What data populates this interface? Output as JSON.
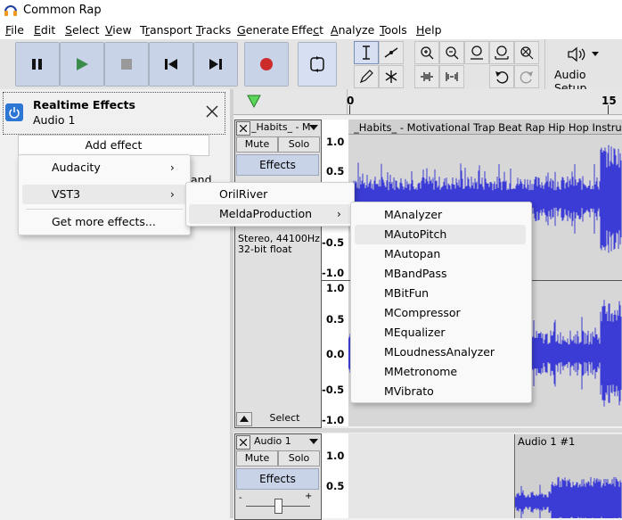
{
  "window": {
    "title": "Common Rap"
  },
  "menubar": [
    {
      "label": "File",
      "u": "F",
      "rest": "ile"
    },
    {
      "label": "Edit",
      "u": "E",
      "rest": "dit"
    },
    {
      "label": "Select",
      "u": "S",
      "rest": "elect"
    },
    {
      "label": "View",
      "u": "V",
      "rest": "iew"
    },
    {
      "label": "Transport",
      "pre": "T",
      "u": "r",
      "rest": "ansport"
    },
    {
      "label": "Tracks",
      "u": "T",
      "rest": "racks"
    },
    {
      "label": "Generate",
      "u": "G",
      "rest": "enerate"
    },
    {
      "label": "Effect",
      "pre": "Effe",
      "u": "c",
      "rest": "t"
    },
    {
      "label": "Analyze",
      "u": "A",
      "rest": "nalyze"
    },
    {
      "label": "Tools",
      "u": "T",
      "rest": "ools"
    },
    {
      "label": "Help",
      "u": "H",
      "rest": "elp"
    }
  ],
  "toolbar": {
    "audio_setup_label": "Audio Setup"
  },
  "realtime": {
    "title": "Realtime Effects",
    "track": "Audio 1",
    "add_effect": "Add effect",
    "partial_text": "and"
  },
  "ruler": {
    "start": "0",
    "mark": "15"
  },
  "track1": {
    "name": "_Habits_ - M",
    "clip_title": "_Habits_ - Motivational Trap Beat  Rap Hip Hop Instrum",
    "mute": "Mute",
    "solo": "Solo",
    "effects": "Effects",
    "format": "Stereo, 44100Hz",
    "bits": "32-bit float",
    "select": "Select",
    "scale": [
      "1.0",
      "0.5",
      "-0.5",
      "-1.0",
      "1.0",
      "0.5",
      "0.0",
      "-0.5",
      "-1.0"
    ]
  },
  "track2": {
    "name": "Audio 1",
    "clip_title": "Audio 1 #1",
    "mute": "Mute",
    "solo": "Solo",
    "effects": "Effects",
    "scale": [
      "1.0",
      "0.5"
    ]
  },
  "menu1": {
    "items": [
      {
        "label": "Audacity",
        "submenu": true
      },
      {
        "label": "VST3",
        "submenu": true
      },
      {
        "label": "Get more effects...",
        "submenu": false
      }
    ]
  },
  "menu2": {
    "items": [
      {
        "label": "OrilRiver",
        "submenu": false
      },
      {
        "label": "MeldaProduction",
        "submenu": true
      }
    ]
  },
  "menu3": {
    "items": [
      "MAnalyzer",
      "MAutoPitch",
      "MAutopan",
      "MBandPass",
      "MBitFun",
      "MCompressor",
      "MEqualizer",
      "MLoudnessAnalyzer",
      "MMetronome",
      "MVibrato"
    ],
    "highlighted": "MAutoPitch"
  },
  "colors": {
    "wave": "#3b3bd6",
    "wave_bg": "#d7d7d7",
    "accent": "#2e76d4",
    "record": "#cc2b2b",
    "play": "#3a8c4a"
  }
}
